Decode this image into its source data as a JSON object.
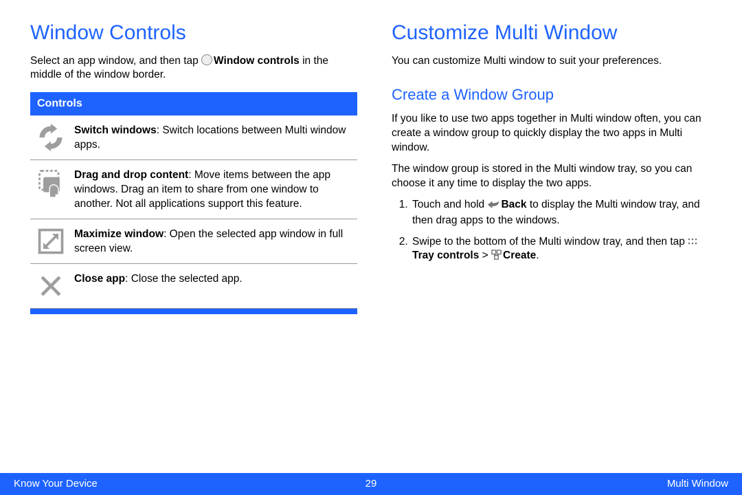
{
  "left": {
    "heading": "Window Controls",
    "intro_before": "Select an app window, and then tap ",
    "intro_bold": "Window controls",
    "intro_after": " in the middle of the window border.",
    "table_header": "Controls",
    "rows": [
      {
        "icon": "switch-icon",
        "bold": "Switch windows",
        "rest": ": Switch locations between Multi window apps."
      },
      {
        "icon": "dragdrop-icon",
        "bold": "Drag and drop content",
        "rest": ": Move items between the app windows. Drag an item to share from one window to another. Not all applications support this feature."
      },
      {
        "icon": "maximize-icon",
        "bold": "Maximize window",
        "rest": ": Open the selected app window in full screen view."
      },
      {
        "icon": "close-icon",
        "bold": "Close app",
        "rest": ": Close the selected app."
      }
    ]
  },
  "right": {
    "heading": "Customize Multi Window",
    "intro": "You can customize Multi window to suit your preferences.",
    "sub_heading": "Create a Window Group",
    "p1": "If you like to use two apps together in Multi window often, you can create a window group to quickly display the two apps in Multi window.",
    "p2": "The window group is stored in the Multi window tray, so you can choose it any time to display the two apps.",
    "step1_before": "Touch and hold ",
    "step1_bold": "Back",
    "step1_after": " to display the Multi window tray, and then drag apps to the windows.",
    "step2_before": "Swipe to the bottom of the Multi window tray, and then tap ",
    "step2_bold1": "Tray controls",
    "step2_sep": " > ",
    "step2_bold2": "Create",
    "step2_end": "."
  },
  "footer": {
    "left": "Know Your Device",
    "center": "29",
    "right": "Multi Window"
  }
}
